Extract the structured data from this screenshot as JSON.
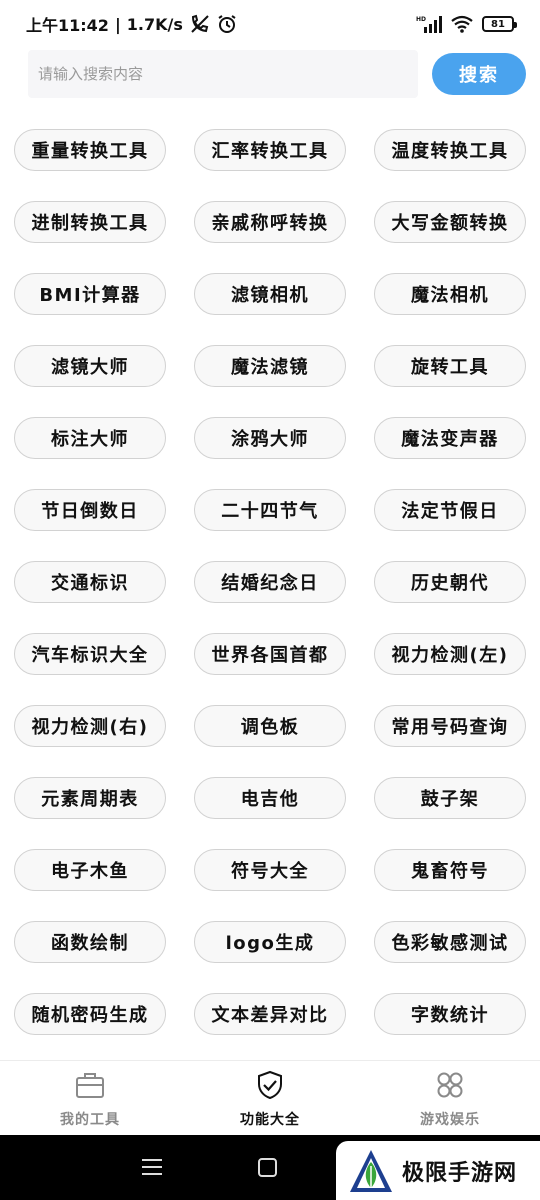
{
  "status_bar": {
    "time": "上午11:42",
    "separator": "|",
    "speed": "1.7K/s",
    "battery": "81",
    "icons": [
      "muted-call-icon",
      "alarm-icon",
      "signal-icon",
      "wifi-icon",
      "battery-icon"
    ]
  },
  "search": {
    "placeholder": "请输入搜索内容",
    "value": "",
    "button_label": "搜索",
    "accent_color": "#4aa3ee"
  },
  "tools": [
    "重量转换工具",
    "汇率转换工具",
    "温度转换工具",
    "进制转换工具",
    "亲戚称呼转换",
    "大写金额转换",
    "BMI计算器",
    "滤镜相机",
    "魔法相机",
    "滤镜大师",
    "魔法滤镜",
    "旋转工具",
    "标注大师",
    "涂鸦大师",
    "魔法变声器",
    "节日倒数日",
    "二十四节气",
    "法定节假日",
    "交通标识",
    "结婚纪念日",
    "历史朝代",
    "汽车标识大全",
    "世界各国首都",
    "视力检测(左)",
    "视力检测(右)",
    "调色板",
    "常用号码查询",
    "元素周期表",
    "电吉他",
    "鼓子架",
    "电子木鱼",
    "符号大全",
    "鬼畜符号",
    "函数绘制",
    "logo生成",
    "色彩敏感测试",
    "随机密码生成",
    "文本差异对比",
    "字数统计"
  ],
  "bottom_nav": {
    "items": [
      {
        "label": "我的工具",
        "icon": "briefcase-icon",
        "active": false
      },
      {
        "label": "功能大全",
        "icon": "shield-check-icon",
        "active": true
      },
      {
        "label": "游戏娱乐",
        "icon": "clover-icon",
        "active": false
      }
    ]
  },
  "watermark": {
    "text": "极限手游网",
    "logo": "watermark-logo-icon"
  }
}
